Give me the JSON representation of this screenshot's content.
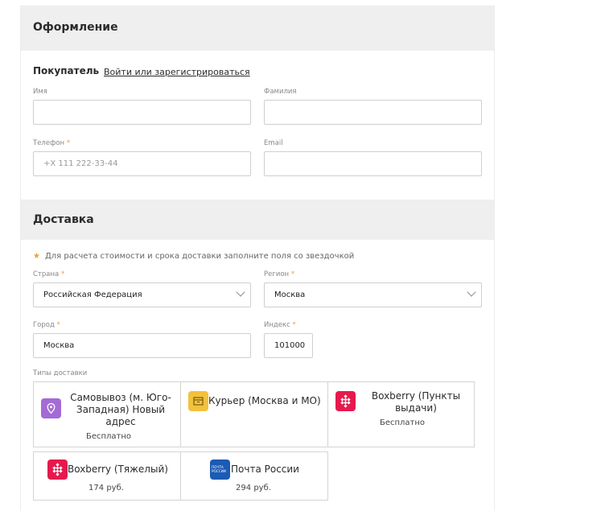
{
  "checkout": {
    "title": "Оформление",
    "buyer": {
      "title": "Покупатель",
      "login_link": "Войти или зарегистрироваться",
      "first_name": {
        "label": "Имя",
        "value": ""
      },
      "last_name": {
        "label": "Фамилия",
        "value": ""
      },
      "phone": {
        "label": "Телефон",
        "required_mark": "*",
        "placeholder": "+X 111 222-33-44"
      },
      "email": {
        "label": "Email",
        "value": ""
      }
    }
  },
  "delivery": {
    "title": "Доставка",
    "note_star": "★",
    "note": "Для расчета стоимости и срока доставки заполните поля со звездочкой",
    "country": {
      "label": "Страна",
      "required_mark": "*",
      "value": "Российская Федерация"
    },
    "region": {
      "label": "Регион",
      "required_mark": "*",
      "value": "Москва"
    },
    "city": {
      "label": "Город",
      "required_mark": "*",
      "value": "Москва"
    },
    "zip": {
      "label": "Индекс",
      "required_mark": "*",
      "value": "101000"
    },
    "types_label": "Типы доставки",
    "types": [
      {
        "name": "Самовывоз (м. Юго-Западная) Новый адрес",
        "price": "Бесплатно",
        "icon": "map-pin-icon",
        "color": "#a46bd6"
      },
      {
        "name": "Курьер (Москва и МО)",
        "price": "",
        "icon": "box-icon",
        "color": "#f2c23c"
      },
      {
        "name": "Boxberry (Пункты выдачи)",
        "price": "Бесплатно",
        "icon": "boxberry-icon",
        "color": "#e6194d"
      },
      {
        "name": "Boxberry (Тяжелый)",
        "price": "174 руб.",
        "icon": "boxberry-icon",
        "color": "#e6194d"
      },
      {
        "name": "Почта России",
        "price": "294 руб.",
        "icon": "russian-post-icon",
        "color": "#1c5bb4",
        "logo_text": "ПОЧТА РОССИИ"
      }
    ]
  }
}
